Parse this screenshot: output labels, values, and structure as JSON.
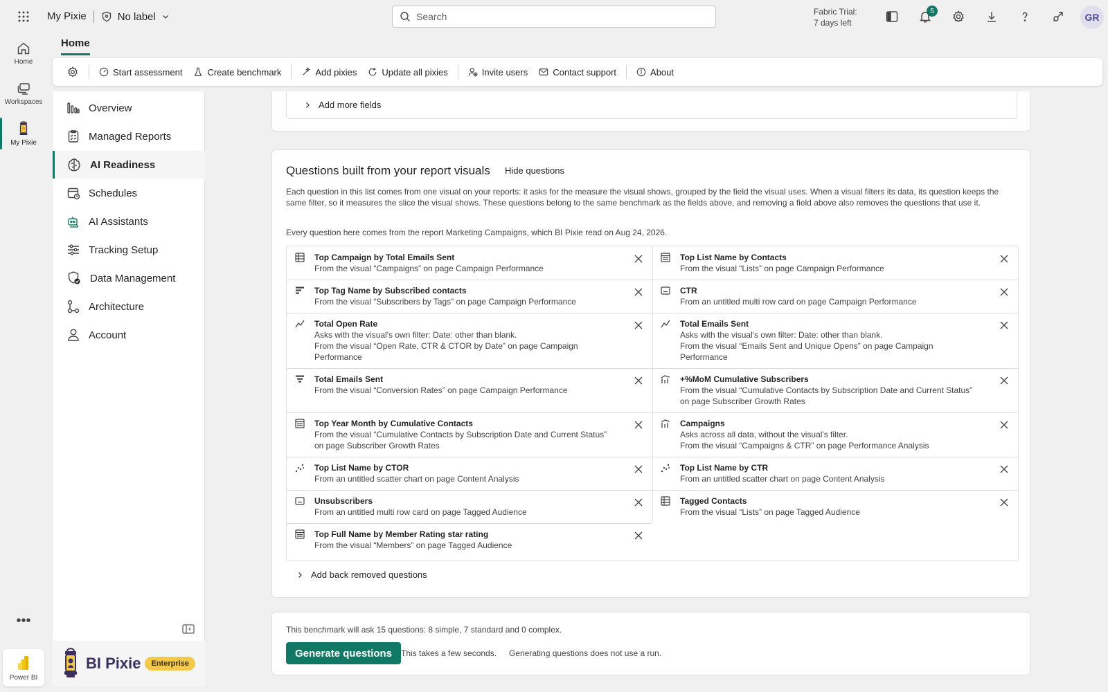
{
  "topbar": {
    "app_name": "My Pixie",
    "label": "No label",
    "search_placeholder": "Search",
    "trial_line1": "Fabric Trial:",
    "trial_line2": "7 days left",
    "notifications_count": "5",
    "avatar_initials": "GR"
  },
  "rail": {
    "home": "Home",
    "workspaces": "Workspaces",
    "mypixie": "My Pixie",
    "more": "•••",
    "powerbi": "Power BI"
  },
  "home_tab": "Home",
  "toolbar": {
    "start_assessment": "Start assessment",
    "create_benchmark": "Create benchmark",
    "add_pixies": "Add pixies",
    "update_all": "Update all pixies",
    "invite_users": "Invite users",
    "contact_support": "Contact support",
    "about": "About"
  },
  "nav": [
    "Overview",
    "Managed Reports",
    "AI Readiness",
    "Schedules",
    "AI Assistants",
    "Tracking Setup",
    "Data Management",
    "Architecture",
    "Account"
  ],
  "brand": {
    "name": "BI Pixie",
    "badge": "Enterprise"
  },
  "fields_card": {
    "add_more": "Add more fields"
  },
  "questions": {
    "title": "Questions built from your report visuals",
    "hide": "Hide questions",
    "description": "Each question in this list comes from one visual on your reports: it asks for the measure the visual shows, grouped by the field the visual uses. When a visual filters its data, its question keeps the same filter, so it measures the slice the visual shows. These questions belong to the same benchmark as the fields above, and removing a field above also removes the questions that use it.",
    "source": "Every question here comes from the report Marketing Campaigns, which BI Pixie read on Aug 24, 2026.",
    "items": [
      {
        "name": "Top Campaign by Total Emails Sent",
        "lines": [
          "From the visual “Campaigns” on page Campaign Performance"
        ]
      },
      {
        "name": "Top List Name by Contacts",
        "lines": [
          "From the visual “Lists” on page Campaign Performance"
        ]
      },
      {
        "name": "Top Tag Name by Subscribed contacts",
        "lines": [
          "From the visual “Subscribers by Tags” on page Campaign Performance"
        ]
      },
      {
        "name": "CTR",
        "lines": [
          "From an untitled multi row card on page Campaign Performance"
        ]
      },
      {
        "name": "Total Open Rate",
        "lines": [
          "Asks with the visual's own filter: Date: other than blank.",
          "From the visual “Open Rate, CTR & CTOR by Date” on page Campaign Performance"
        ]
      },
      {
        "name": "Total Emails Sent",
        "lines": [
          "Asks with the visual's own filter: Date: other than blank.",
          "From the visual “Emails Sent and Unique Opens” on page Campaign Performance"
        ]
      },
      {
        "name": "Total Emails Sent",
        "lines": [
          "From the visual “Conversion Rates” on page Campaign Performance"
        ]
      },
      {
        "name": "+%MoM Cumulative Subscribers",
        "lines": [
          "From the visual “Cumulative Contacts by Subscription Date and Current Status” on page Subscriber Growth Rates"
        ]
      },
      {
        "name": "Top Year Month by Cumulative Contacts",
        "lines": [
          "From the visual “Cumulative Contacts by Subscription Date and Current Status” on page Subscriber Growth Rates"
        ]
      },
      {
        "name": "Campaigns",
        "lines": [
          "Asks across all data, without the visual's filter.",
          "From the visual “Campaigns & CTR” on page Performance Analysis"
        ]
      },
      {
        "name": "Top List Name by CTOR",
        "lines": [
          "From an untitled scatter chart on page Content Analysis"
        ]
      },
      {
        "name": "Top List Name by CTR",
        "lines": [
          "From an untitled scatter chart on page Content Analysis"
        ]
      },
      {
        "name": "Unsubscribers",
        "lines": [
          "From an untitled multi row card on page Tagged Audience"
        ]
      },
      {
        "name": "Tagged Contacts",
        "lines": [
          "From the visual “Lists” on page Tagged Audience"
        ]
      },
      {
        "name": "Top Full Name by Member Rating star rating",
        "lines": [
          "From the visual “Members” on page Tagged Audience"
        ]
      }
    ],
    "add_back": "Add back removed questions"
  },
  "benchmark": {
    "summary": "This benchmark will ask 15 questions: 8 simple, 7 standard and 0 complex.",
    "generate": "Generate questions",
    "note1": "This takes a few seconds.",
    "note2": "Generating questions does not use a run."
  },
  "colors": {
    "accent": "#117865",
    "badge": "#f2c94c"
  }
}
